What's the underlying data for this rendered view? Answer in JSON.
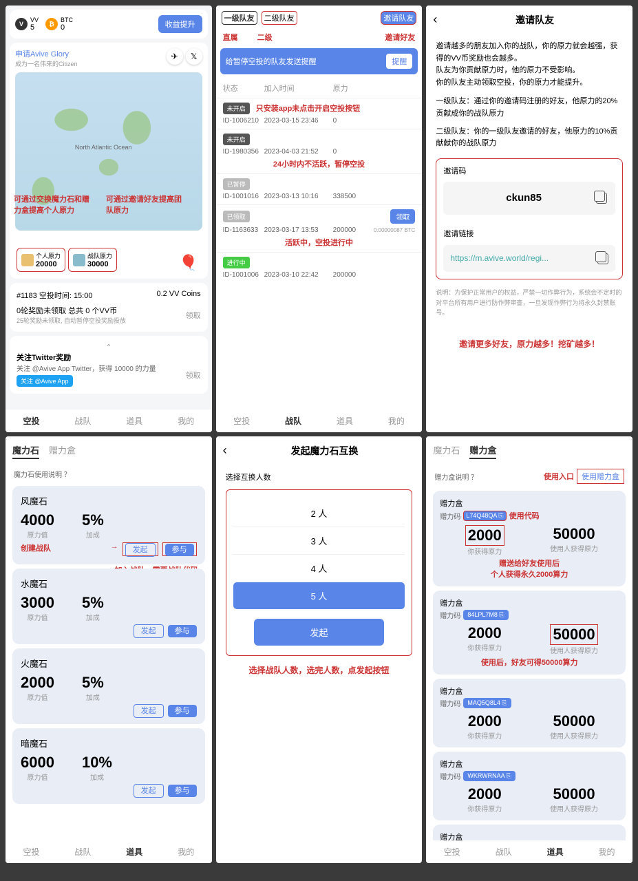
{
  "s1": {
    "vv_label": "VV",
    "vv_value": "5",
    "btc_label": "BTC",
    "btc_value": "0",
    "boost_btn": "收益提升",
    "apply_glory": "申请Avive Glory",
    "glory_sub": "成为一名伟来的Citizen",
    "map_ocean": "North Atlantic Ocean",
    "anno_left": "可通过交换魔力石和赠力盒提高个人原力",
    "anno_right": "可通过邀请好友提高团队原力",
    "personal_label": "个人原力",
    "personal_val": "20000",
    "team_label": "战队原力",
    "team_val": "30000",
    "round_info": "#1183 空投时间: 15:00",
    "vv_coins": "0.2 VV Coins",
    "reward_line": "0轮奖励未领取 总共 0 个VV币",
    "reward_sub": "25轮奖励未领取, 自动暂停空投奖励投放",
    "claim": "领取",
    "twitter_title": "关注Twitter奖励",
    "twitter_sub": "关注 @Avive App Twitter，获得 10000 的力量",
    "twitter_btn": "关注 @Avive App",
    "tabs": [
      "空投",
      "战队",
      "道具",
      "我的"
    ]
  },
  "s2": {
    "tab1": "一级队友",
    "tab2": "二级队友",
    "invite_btn": "邀请队友",
    "anno_l": "直属",
    "anno_m": "二级",
    "anno_r": "邀请好友",
    "remind_text": "给暂停空投的队友发送提醒",
    "remind_btn": "提醒",
    "h1": "状态",
    "h2": "加入时间",
    "h3": "原力",
    "r1": {
      "status": "未开启",
      "color": "#555",
      "id": "ID-1006210",
      "time": "2023-03-15 23:46",
      "power": "0"
    },
    "a1": "只安装app未点击开启空投按钮",
    "r2": {
      "status": "未开启",
      "color": "#555",
      "id": "ID-1980356",
      "time": "2023-04-03 21:52",
      "power": "0"
    },
    "a2": "24小时内不活跃，暂停空投",
    "r3": {
      "status": "已暂停",
      "color": "#bbb",
      "id": "ID-1001016",
      "time": "2023-03-13 10:16",
      "power": "338500"
    },
    "r4": {
      "status": "已领取",
      "color": "#bbb",
      "id": "ID-1163633",
      "time": "2023-03-17 13:53",
      "power": "200000",
      "btc": "0.00000087 BTC"
    },
    "r4_btn": "领取",
    "a3": "活跃中，空投进行中",
    "r5": {
      "status": "进行中",
      "color": "#4c4",
      "id": "ID-1001006",
      "time": "2023-03-10 22:42",
      "power": "200000"
    }
  },
  "s3": {
    "title": "邀请队友",
    "p1": "邀请越多的朋友加入你的战队，你的原力就会越强，获得的VV币奖励也会越多。",
    "p2": "队友为你贡献原力时，他的原力不受影响。",
    "p3": "你的队友主动领取空投，你的原力才能提升。",
    "p4": "一级队友：通过你的邀请码注册的好友，他原力的20%贡献成你的战队原力",
    "p5": "二级队友：你的一级队友邀请的好友，他原力的10%贡献献你的战队原力",
    "code_label": "邀请码",
    "code": "ckun85",
    "link_label": "邀请链接",
    "link": "https://m.avive.world/regi...",
    "disclaimer": "说明：为保护正常用户的权益，严禁一切作弊行为，系统会不定时的对平台所有用户进行防作弊审查，一旦发现作弊行为将永久封禁账号。",
    "anno": "邀请更多好友，原力越多！挖矿越多！"
  },
  "s4": {
    "tab1": "魔力石",
    "tab2": "赠力盒",
    "help": "魔力石使用说明 ？",
    "stones": [
      {
        "name": "风魔石",
        "power": "4000",
        "pct": "5%"
      },
      {
        "name": "水魔石",
        "power": "3000",
        "pct": "5%"
      },
      {
        "name": "火魔石",
        "power": "2000",
        "pct": "5%"
      },
      {
        "name": "暗魔石",
        "power": "6000",
        "pct": "10%"
      }
    ],
    "power_lbl": "原力值",
    "pct_lbl": "加成",
    "btn1": "发起",
    "btn2": "参与",
    "a1": "创建战队",
    "a2": "加入战队，需要战队代码"
  },
  "s5": {
    "title": "发起魔力石互换",
    "sub": "选择互换人数",
    "opts": [
      "2 人",
      "3 人",
      "4 人",
      "5 人"
    ],
    "launch": "发起",
    "anno": "选择战队人数，选完人数，点发起按钮"
  },
  "s6": {
    "tab1": "魔力石",
    "tab2": "赠力盒",
    "help": "赠力盒说明 ？",
    "entry_anno": "使用入口",
    "entry_btn": "使用赠力盒",
    "box_title": "赠力盒",
    "code_lbl": "赠力码",
    "codes": [
      "L74Q48QA",
      "84LPL7M8",
      "MAQ5Q8L4",
      "WKRWRNAA"
    ],
    "v1": "2000",
    "v1_lbl": "你获得原力",
    "v2": "50000",
    "v2_lbl": "使用人获得原力",
    "a1": "使用代码",
    "a2": "赠送给好友使用后",
    "a3": "个人获得永久2000算力",
    "a4": "使用后，好友可得50000算力"
  }
}
